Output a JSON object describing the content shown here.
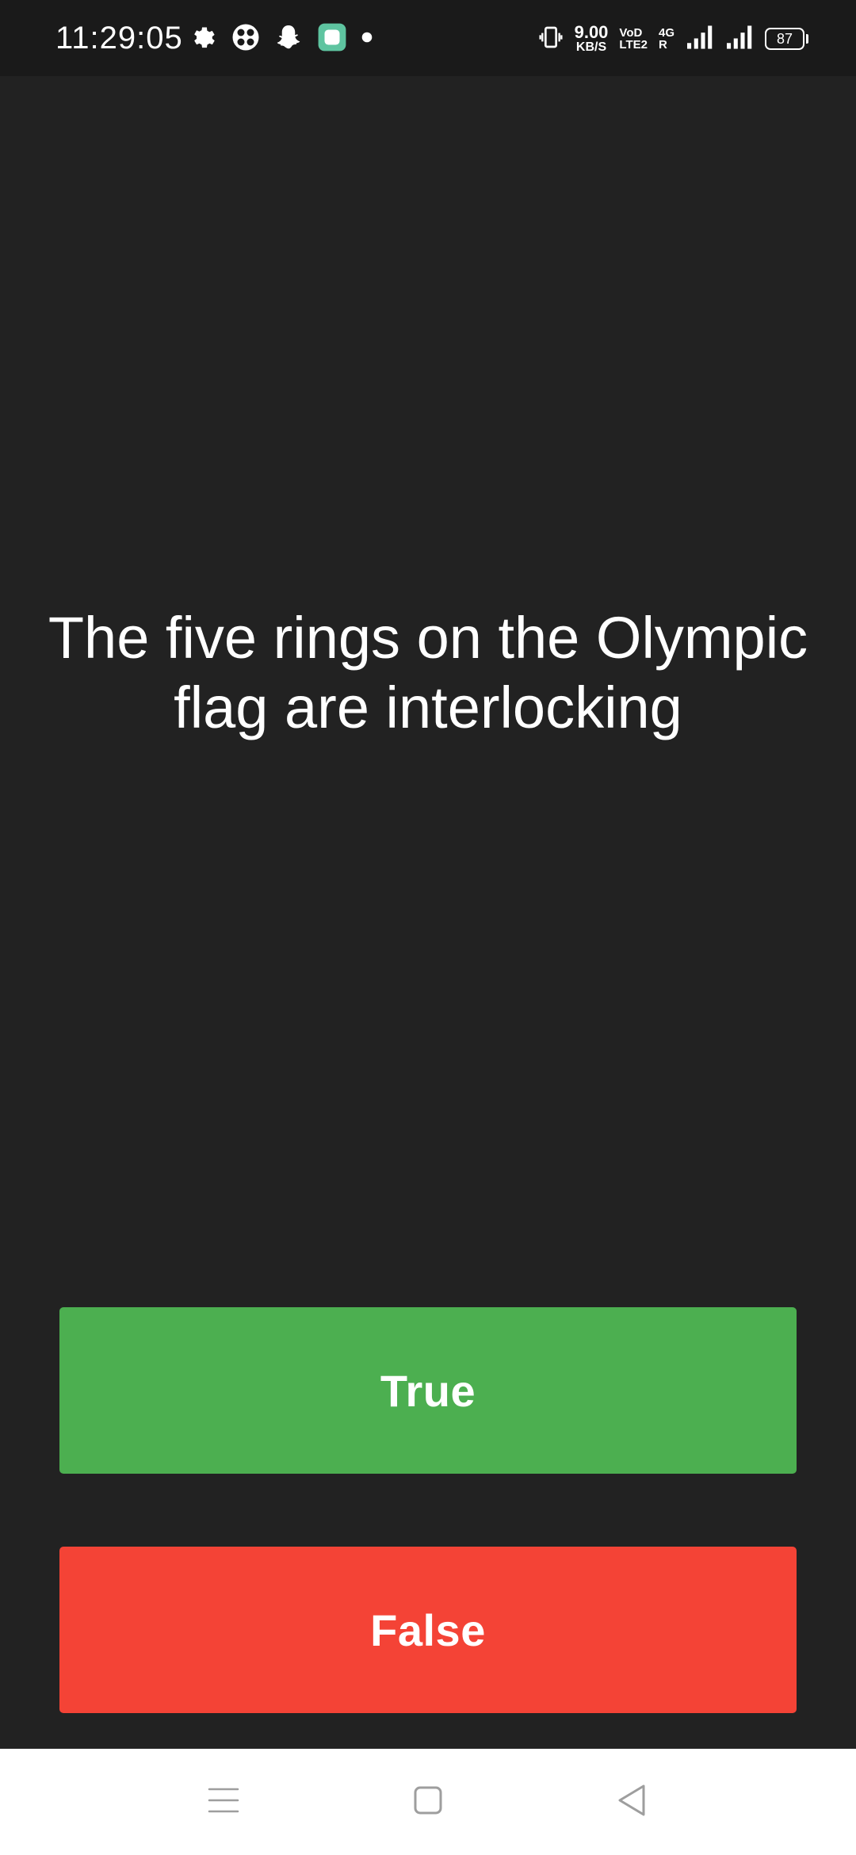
{
  "status_bar": {
    "time": "11:29:05",
    "left_icons": [
      "settings-icon",
      "app-grid-icon",
      "snapchat-icon",
      "app-badge-icon",
      "notification-dot-icon"
    ],
    "vibrate_icon": "vibrate-icon",
    "speed_value": "9.00",
    "speed_unit": "KB/S",
    "volte_top": "VoD",
    "volte_bottom": "LTE2",
    "net_type": "4G",
    "net_r": "R",
    "battery": "87"
  },
  "quiz": {
    "question": "The five rings on the Olympic flag are interlocking",
    "true_label": "True",
    "false_label": "False",
    "true_color": "#4caf50",
    "false_color": "#f44336"
  },
  "nav_bar": {
    "menu_icon": "menu-icon",
    "home_icon": "home-icon",
    "back_icon": "back-icon"
  }
}
